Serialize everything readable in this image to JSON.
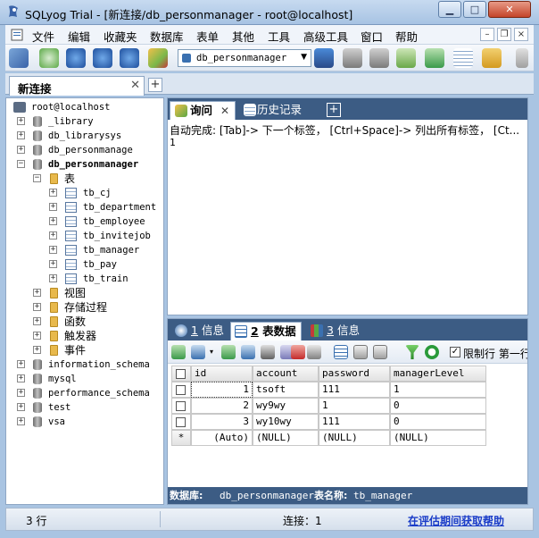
{
  "window": {
    "title": "SQLyog Trial - [新连接/db_personmanager - root@localhost]",
    "min": "▁",
    "max": "□",
    "close": "✕"
  },
  "menu": {
    "items": [
      "文件",
      "编辑",
      "收藏夹",
      "数据库",
      "表单",
      "其他",
      "工具",
      "高级工具",
      "窗口",
      "帮助"
    ],
    "mdi_min": "–",
    "mdi_restore": "❐",
    "mdi_close": "×"
  },
  "toolbar": {
    "database_selected": "db_personmanager",
    "dropdown_arrow": "▼"
  },
  "connection_tab": {
    "label": "新连接",
    "close": "✕",
    "add": "+"
  },
  "tree": {
    "root": "root@localhost",
    "databases": [
      "_library",
      "db_librarysys",
      "db_personmanage",
      "db_personmanager"
    ],
    "folder_tables": "表",
    "tables": [
      "tb_cj",
      "tb_department",
      "tb_employee",
      "tb_invitejob",
      "tb_manager",
      "tb_pay",
      "tb_train"
    ],
    "folders": [
      "视图",
      "存储过程",
      "函数",
      "触发器",
      "事件"
    ],
    "other_databases": [
      "information_schema",
      "mysql",
      "performance_schema",
      "test",
      "vsa"
    ],
    "expand": "+",
    "collapse": "−"
  },
  "query": {
    "tab_query": "询问",
    "tab_history": "历史记录",
    "tab_close": "✕",
    "tab_add": "+",
    "autocomplete_hint": "自动完成: [Tab]-> 下一个标签， [Ctrl+Space]-> 列出所有标签， [Ct...",
    "line1": "1"
  },
  "result": {
    "tabs": [
      {
        "num": "1",
        "label": "信息"
      },
      {
        "num": "2",
        "label": "表数据"
      },
      {
        "num": "3",
        "label": "信息"
      }
    ],
    "limit_checked": "✓",
    "limit_label": "限制行  第一行",
    "columns": [
      "id",
      "account",
      "password",
      "managerLevel"
    ],
    "rows": [
      [
        "1",
        "tsoft",
        "111",
        "1"
      ],
      [
        "2",
        "wy9wy",
        "1",
        "0"
      ],
      [
        "3",
        "wy10wy",
        "111",
        "0"
      ]
    ],
    "new_row_marker": "*",
    "new_row": [
      "(Auto)",
      "(NULL)",
      "(NULL)",
      "(NULL)"
    ],
    "footer_db_label": "数据库:",
    "footer_db_value": "db_personmanager",
    "footer_table_label": "表名称:",
    "footer_table_value": "tb_manager"
  },
  "status": {
    "rows": "3 行",
    "connection": "连接：1",
    "help_link": "在评估期间获取帮助"
  }
}
